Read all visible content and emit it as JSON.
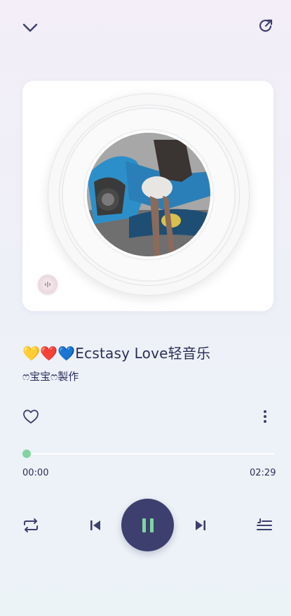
{
  "song": {
    "title": "💛❤️💙Ecstasy Love轻音乐",
    "artist": "ෆ宝宝ෆ製作"
  },
  "player": {
    "current_time": "00:00",
    "total_time": "02:29",
    "progress": 0
  },
  "colors": {
    "accent": "#7fd4a2",
    "primary": "#3d3f6e",
    "text": "#2b2f5a"
  },
  "icons": {
    "collapse": "chevron-down-icon",
    "share": "share-icon",
    "like": "heart-icon",
    "more": "more-vertical-icon",
    "repeat": "repeat-icon",
    "previous": "skip-previous-icon",
    "pause": "pause-icon",
    "next": "skip-next-icon",
    "queue": "playlist-icon",
    "volume": "sound-icon"
  }
}
